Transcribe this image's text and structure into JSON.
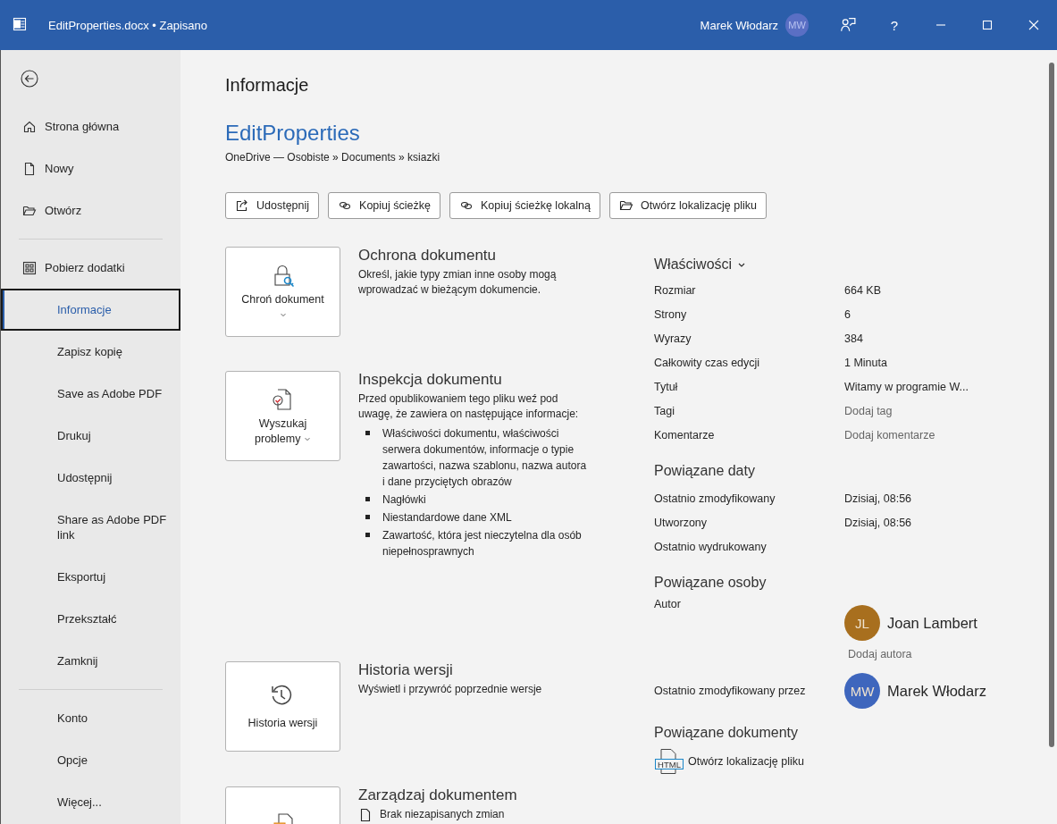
{
  "window": {
    "title": "EditProperties.docx • Zapisano",
    "user": "Marek Włodarz",
    "user_initials": "MW",
    "help": "?"
  },
  "sidebar": {
    "top_items": [
      {
        "label": "Strona główna",
        "selected": false
      },
      {
        "label": "Nowy",
        "selected": false
      },
      {
        "label": "Otwórz",
        "selected": false
      }
    ],
    "addin_items": [
      {
        "label": "Pobierz dodatki",
        "selected": false
      }
    ],
    "items": [
      {
        "label": "Informacje",
        "selected": true
      },
      {
        "label": "Zapisz kopię",
        "selected": false
      },
      {
        "label": "Save as Adobe PDF",
        "selected": false
      },
      {
        "label": "Drukuj",
        "selected": false
      },
      {
        "label": "Udostępnij",
        "selected": false
      },
      {
        "label": "Share as Adobe PDF link",
        "selected": false
      },
      {
        "label": "Eksportuj",
        "selected": false
      },
      {
        "label": "Przekształć",
        "selected": false
      },
      {
        "label": "Zamknij",
        "selected": false
      }
    ],
    "bottom_items": [
      {
        "label": "Konto",
        "selected": false
      },
      {
        "label": "Opcje",
        "selected": false
      },
      {
        "label": "Więcej...",
        "selected": false
      }
    ]
  },
  "page": {
    "heading": "Informacje",
    "doc_name": "EditProperties",
    "path": "OneDrive — Osobiste » Documents » ksiazki",
    "actions": [
      {
        "label": "Udostępnij",
        "kind": "share"
      },
      {
        "label": "Kopiuj ścieżkę",
        "kind": "link"
      },
      {
        "label": "Kopiuj ścieżkę lokalną",
        "kind": "link"
      },
      {
        "label": "Otwórz lokalizację pliku",
        "kind": "folder"
      }
    ],
    "sections": [
      {
        "kind": "protect",
        "card_label": "Chroń dokument",
        "dropdown": true,
        "title": "Ochrona dokumentu",
        "text": "Określ, jakie typy zmian inne osoby mogą wprowadzać w bieżącym dokumencie."
      },
      {
        "kind": "inspect",
        "card_label": "Wyszukaj problemy",
        "dropdown": true,
        "title": "Inspekcja dokumentu",
        "text": "Przed opublikowaniem tego pliku weź pod uwagę, że zawiera on następujące informacje:",
        "bullets": [
          "Właściwości dokumentu, właściwości serwera dokumentów, informacje o typie zawartości, nazwa szablonu, nazwa autora i dane przyciętych obrazów",
          "Nagłówki",
          "Niestandardowe dane XML",
          "Zawartość, która jest nieczytelna dla osób niepełnosprawnych"
        ]
      },
      {
        "kind": "history",
        "card_label": "Historia wersji",
        "dropdown": false,
        "title": "Historia wersji",
        "text": "Wyświetl i przywróć poprzednie wersje"
      },
      {
        "kind": "manage",
        "title": "Zarządzaj dokumentem",
        "text": "Brak niezapisanych zmian"
      }
    ]
  },
  "properties": {
    "title": "Właściwości",
    "rows": [
      {
        "label": "Rozmiar",
        "value": "664 KB",
        "kind": "value"
      },
      {
        "label": "Strony",
        "value": "6",
        "kind": "value"
      },
      {
        "label": "Wyrazy",
        "value": "384",
        "kind": "value"
      },
      {
        "label": "Całkowity czas edycji",
        "value": "1 Minuta",
        "kind": "value"
      },
      {
        "label": "Tytuł",
        "value": "Witamy w programie W...",
        "kind": "value"
      },
      {
        "label": "Tagi",
        "value": "Dodaj tag",
        "kind": "hint"
      },
      {
        "label": "Komentarze",
        "value": "Dodaj komentarze",
        "kind": "hint"
      }
    ],
    "dates_title": "Powiązane daty",
    "dates": [
      {
        "label": "Ostatnio zmodyfikowany",
        "value": "Dzisiaj, 08:56"
      },
      {
        "label": "Utworzony",
        "value": "Dzisiaj, 08:56"
      },
      {
        "label": "Ostatnio wydrukowany"
      }
    ],
    "people_title": "Powiązane osoby",
    "author_label": "Autor",
    "author": {
      "initials": "JL",
      "name": "Joan Lambert",
      "color": "#a86f1e"
    },
    "add_author": "Dodaj autora",
    "modified_by_label": "Ostatnio zmodyfikowany przez",
    "modified_by": {
      "initials": "MW",
      "name": "Marek Włodarz",
      "color": "#3e66bd"
    },
    "docs_title": "Powiązane dokumenty",
    "doc_link": {
      "icon_label": "HTML",
      "label": "Otwórz lokalizację pliku"
    }
  }
}
